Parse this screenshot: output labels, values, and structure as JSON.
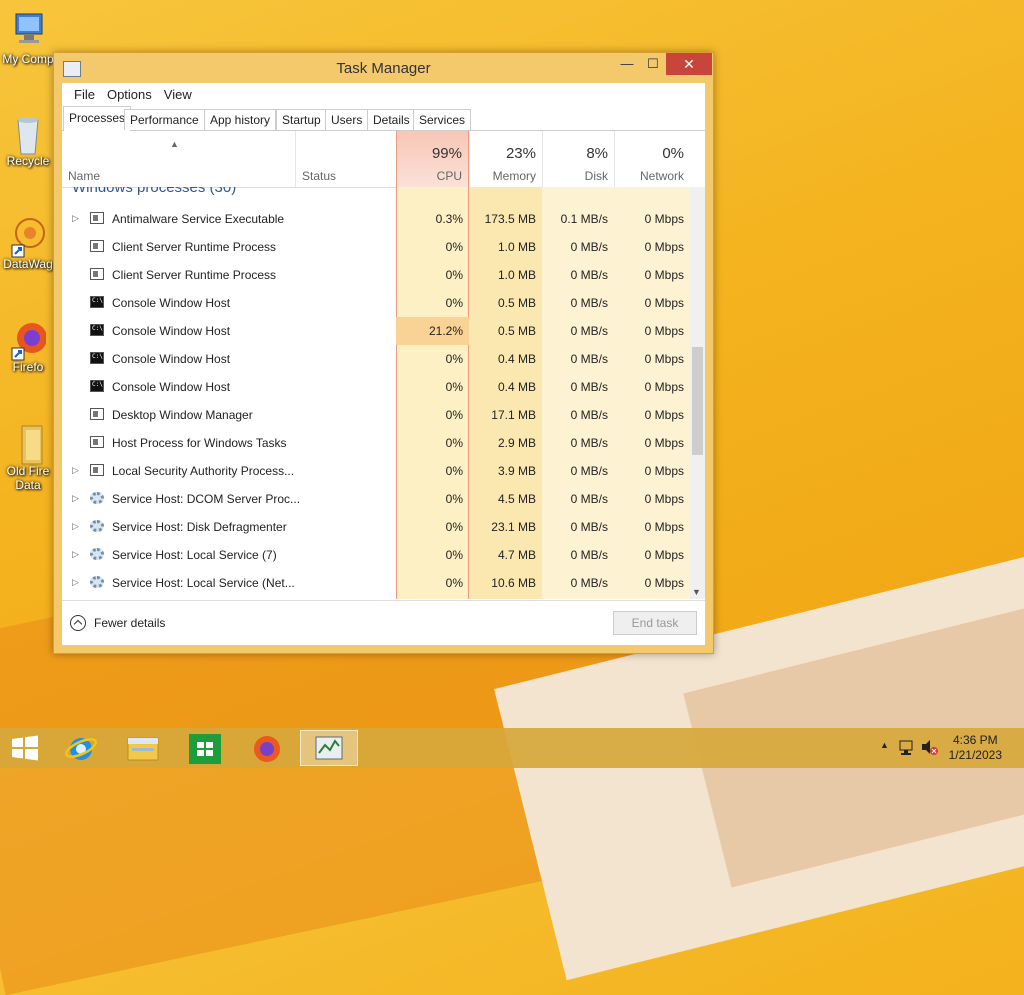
{
  "desktop": {
    "icons": [
      {
        "label": "My Comp",
        "icon": "computer-icon"
      },
      {
        "label": "Recycle",
        "icon": "recycle-bin-icon"
      },
      {
        "label": "DataWag",
        "icon": "datawag-icon"
      },
      {
        "label": "Firefo",
        "icon": "firefox-icon"
      },
      {
        "label": "Old Fire",
        "label2": "Data",
        "icon": "folder-icon"
      }
    ]
  },
  "window": {
    "title": "Task Manager",
    "controls": {
      "minimize": "—",
      "maximize": "☐",
      "close": "✕"
    },
    "menu": [
      "File",
      "Options",
      "View"
    ],
    "tabs": [
      "Processes",
      "Performance",
      "App history",
      "Startup",
      "Users",
      "Details",
      "Services"
    ],
    "active_tab": "Processes",
    "columns": {
      "name": "Name",
      "status": "Status",
      "cpu": {
        "pct": "99%",
        "label": "CPU"
      },
      "memory": {
        "pct": "23%",
        "label": "Memory"
      },
      "disk": {
        "pct": "8%",
        "label": "Disk"
      },
      "network": {
        "pct": "0%",
        "label": "Network"
      }
    },
    "group_title": "Windows processes (30)",
    "rows": [
      {
        "expand": true,
        "icon": "app",
        "name": "Antimalware Service Executable",
        "cpu": "0.3%",
        "memory": "173.5 MB",
        "disk": "0.1 MB/s",
        "network": "0 Mbps"
      },
      {
        "expand": false,
        "icon": "app",
        "name": "Client Server Runtime Process",
        "cpu": "0%",
        "memory": "1.0 MB",
        "disk": "0 MB/s",
        "network": "0 Mbps"
      },
      {
        "expand": false,
        "icon": "app",
        "name": "Client Server Runtime Process",
        "cpu": "0%",
        "memory": "1.0 MB",
        "disk": "0 MB/s",
        "network": "0 Mbps"
      },
      {
        "expand": false,
        "icon": "console",
        "name": "Console Window Host",
        "cpu": "0%",
        "memory": "0.5 MB",
        "disk": "0 MB/s",
        "network": "0 Mbps"
      },
      {
        "expand": false,
        "icon": "console",
        "name": "Console Window Host",
        "cpu": "21.2%",
        "memory": "0.5 MB",
        "disk": "0 MB/s",
        "network": "0 Mbps",
        "hot": true
      },
      {
        "expand": false,
        "icon": "console",
        "name": "Console Window Host",
        "cpu": "0%",
        "memory": "0.4 MB",
        "disk": "0 MB/s",
        "network": "0 Mbps"
      },
      {
        "expand": false,
        "icon": "console",
        "name": "Console Window Host",
        "cpu": "0%",
        "memory": "0.4 MB",
        "disk": "0 MB/s",
        "network": "0 Mbps"
      },
      {
        "expand": false,
        "icon": "app",
        "name": "Desktop Window Manager",
        "cpu": "0%",
        "memory": "17.1 MB",
        "disk": "0 MB/s",
        "network": "0 Mbps"
      },
      {
        "expand": false,
        "icon": "app",
        "name": "Host Process for Windows Tasks",
        "cpu": "0%",
        "memory": "2.9 MB",
        "disk": "0 MB/s",
        "network": "0 Mbps"
      },
      {
        "expand": true,
        "icon": "app",
        "name": "Local Security Authority Process...",
        "cpu": "0%",
        "memory": "3.9 MB",
        "disk": "0 MB/s",
        "network": "0 Mbps"
      },
      {
        "expand": true,
        "icon": "gear",
        "name": "Service Host: DCOM Server Proc...",
        "cpu": "0%",
        "memory": "4.5 MB",
        "disk": "0 MB/s",
        "network": "0 Mbps"
      },
      {
        "expand": true,
        "icon": "gear",
        "name": "Service Host: Disk Defragmenter",
        "cpu": "0%",
        "memory": "23.1 MB",
        "disk": "0 MB/s",
        "network": "0 Mbps"
      },
      {
        "expand": true,
        "icon": "gear",
        "name": "Service Host: Local Service (7)",
        "cpu": "0%",
        "memory": "4.7 MB",
        "disk": "0 MB/s",
        "network": "0 Mbps"
      },
      {
        "expand": true,
        "icon": "gear",
        "name": "Service Host: Local Service (Net...",
        "cpu": "0%",
        "memory": "10.6 MB",
        "disk": "0 MB/s",
        "network": "0 Mbps"
      }
    ],
    "footer": {
      "fewer_details": "Fewer details",
      "end_task": "End task"
    },
    "colors": {
      "cpu_header": "#f8c6b6",
      "cell_light": "#fdf3cf",
      "cell_mid": "#fbe9b4",
      "cell_hot": "#f9d395"
    }
  },
  "taskbar": {
    "items": [
      "start-icon",
      "internet-explorer-icon",
      "file-explorer-icon",
      "store-icon",
      "firefox-icon",
      "task-manager-icon"
    ],
    "clock": {
      "time": "4:36 PM",
      "date": "1/21/2023"
    }
  }
}
